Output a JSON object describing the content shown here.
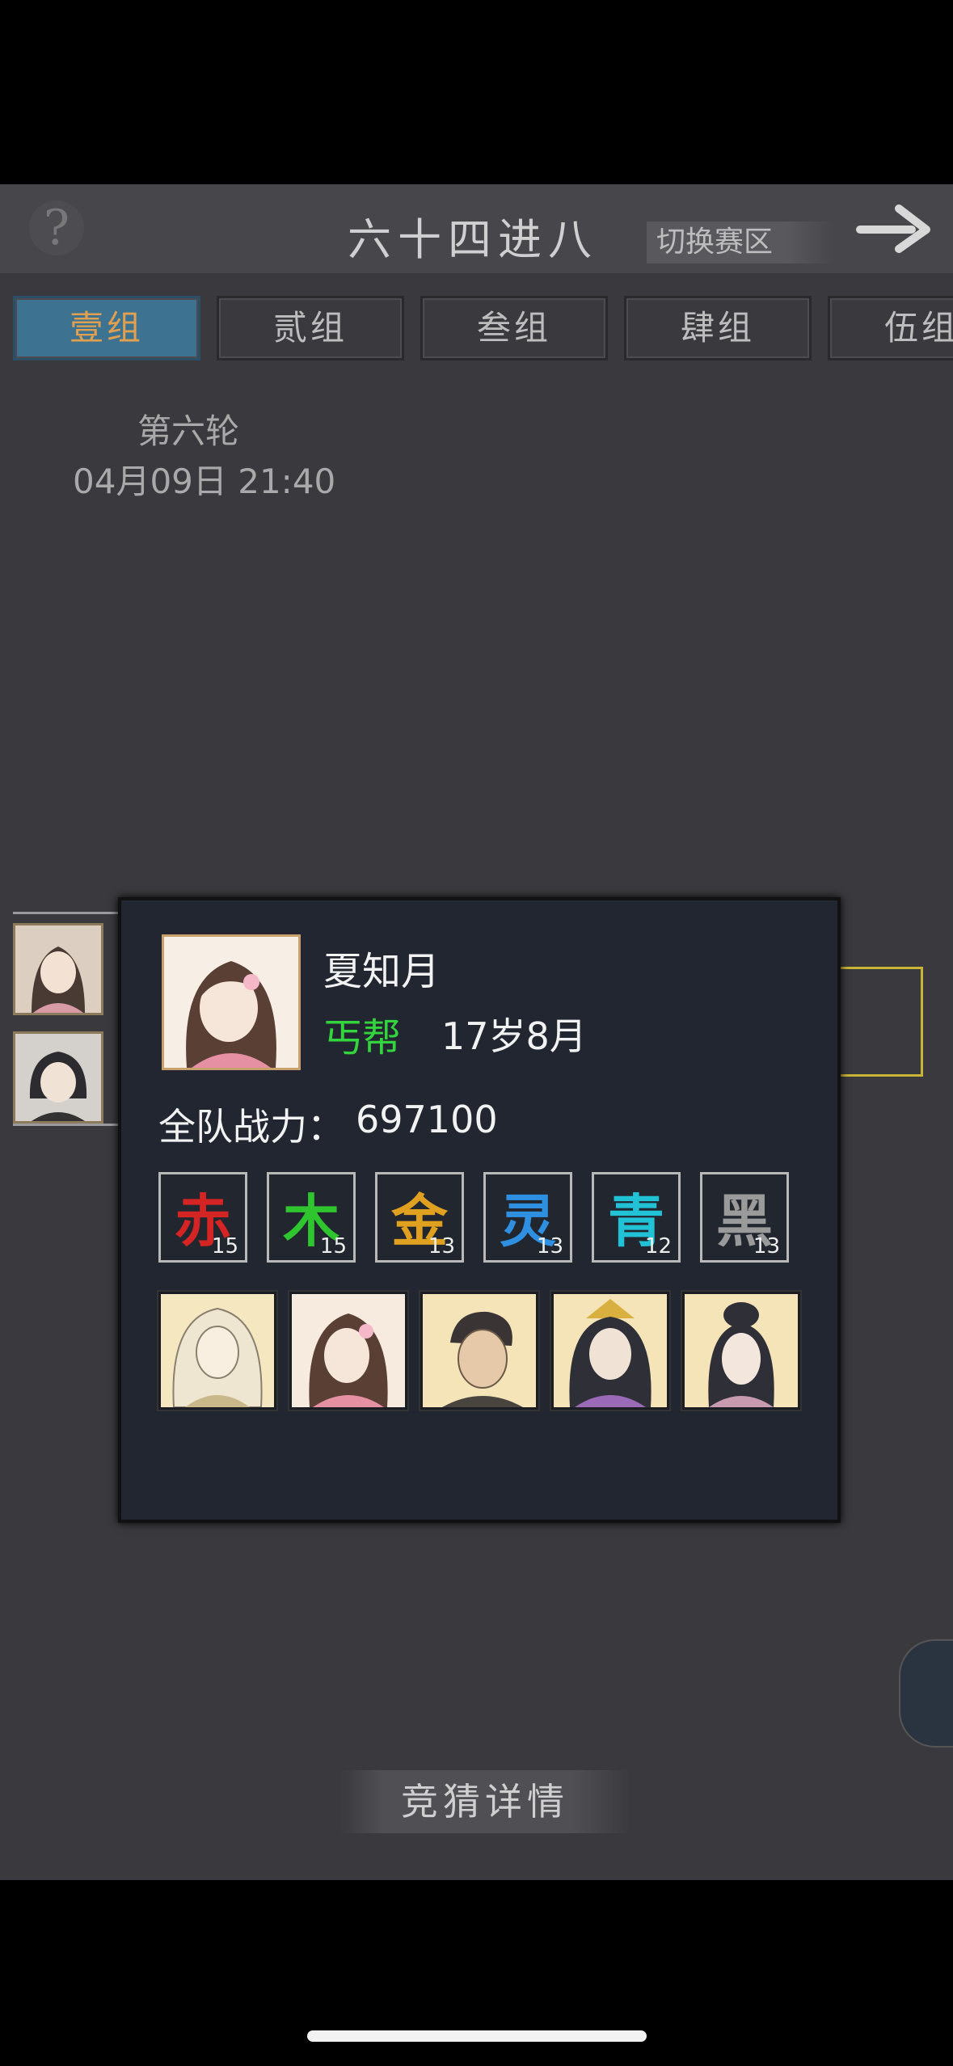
{
  "header": {
    "title": "六十四进八",
    "switch_label": "切换赛区"
  },
  "tabs": [
    {
      "label": "壹组",
      "active": true
    },
    {
      "label": "贰组",
      "active": false
    },
    {
      "label": "叁组",
      "active": false
    },
    {
      "label": "肆组",
      "active": false
    },
    {
      "label": "伍组",
      "active": false
    }
  ],
  "round": {
    "label": "第六轮",
    "time": "04月09日 21:40"
  },
  "popup": {
    "name": "夏知月",
    "sect": "丐帮",
    "age": "17岁8月",
    "power_label": "全队战力：",
    "power_value": "697100",
    "attributes": [
      {
        "char": "赤",
        "value": "15",
        "color": "#d42424"
      },
      {
        "char": "木",
        "value": "15",
        "color": "#2fc52f"
      },
      {
        "char": "金",
        "value": "13",
        "color": "#e0a020"
      },
      {
        "char": "灵",
        "value": "13",
        "color": "#2f8fe0"
      },
      {
        "char": "青",
        "value": "12",
        "color": "#22c2d6"
      },
      {
        "char": "黑",
        "value": "13",
        "color": "#9a9a9a"
      }
    ]
  },
  "footer": {
    "guess_label": "竞猜详情"
  }
}
